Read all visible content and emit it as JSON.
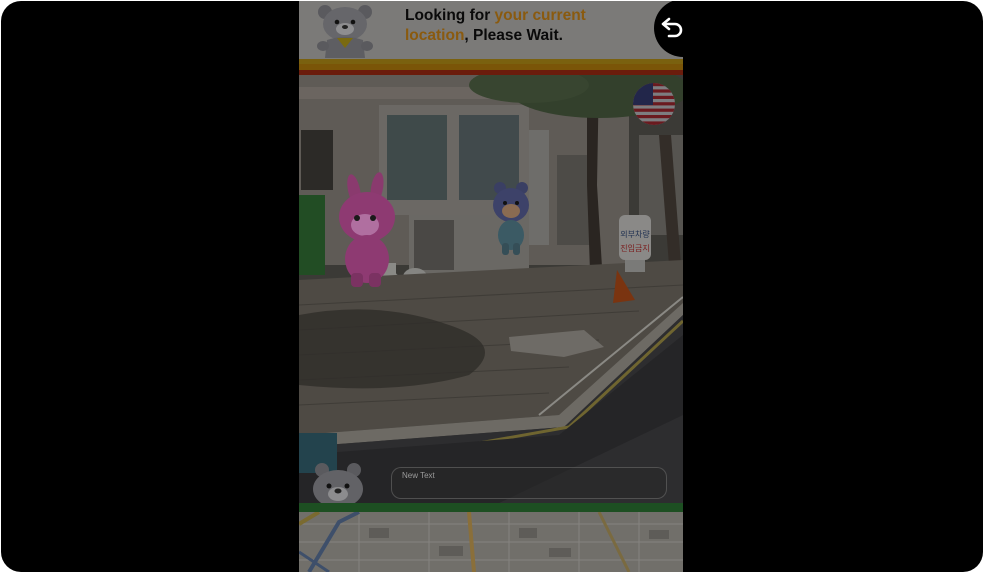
{
  "header": {
    "message_prefix": "Looking for ",
    "message_highlight_1": "your current",
    "message_highlight_2": "location",
    "message_suffix": ", Please Wait."
  },
  "buttons": {
    "back_icon": "back-arrow-icon",
    "flag_icon": "us-flag-icon",
    "bear_icon": "bear-face-icon"
  },
  "input": {
    "placeholder": "New Text"
  },
  "scene": {
    "sign_line_1": "외부차량",
    "sign_line_2": "진입금지"
  },
  "colors": {
    "highlight": "#8a5a0e",
    "stripe_yellow": "#7a610f",
    "stripe_orange": "#7a5508",
    "stripe_red": "#6b1c0c",
    "bottom_bar_green": "#1d4f22"
  }
}
